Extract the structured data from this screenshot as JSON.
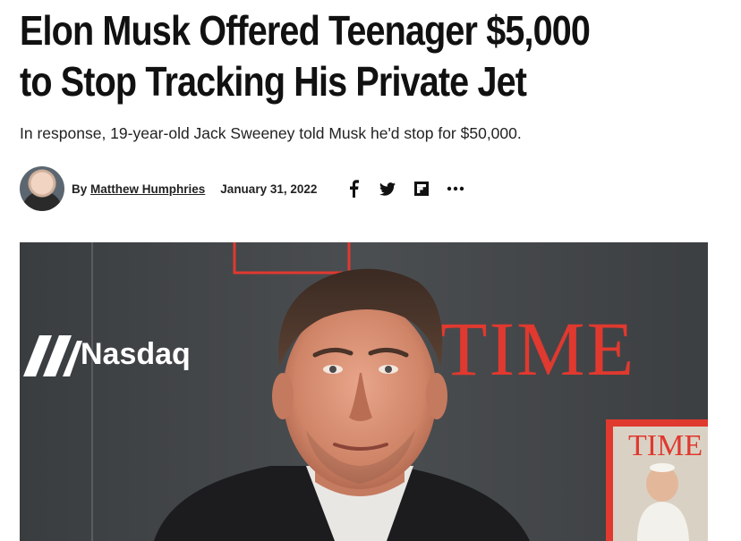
{
  "article": {
    "headline": "Elon Musk Offered Teenager $5,000 to Stop Tracking His Private Jet",
    "dek": "In response, 19-year-old Jack Sweeney told Musk he'd stop for $50,000.",
    "byline": {
      "prefix": "By",
      "author": "Matthew Humphries",
      "date": "January 31, 2022"
    },
    "share": {
      "icons": [
        "facebook-icon",
        "twitter-icon",
        "flipboard-icon",
        "more-icon"
      ],
      "more_label": "•••"
    }
  },
  "hero_image": {
    "backdrop_text": {
      "nasdaq": "Nasdaq",
      "time": "TIME",
      "time_partial": "TI",
      "magazine_title": "TIME"
    },
    "colors": {
      "backdrop": "#45484b",
      "time_red": "#e0392f",
      "nasdaq_white": "#ffffff"
    }
  }
}
